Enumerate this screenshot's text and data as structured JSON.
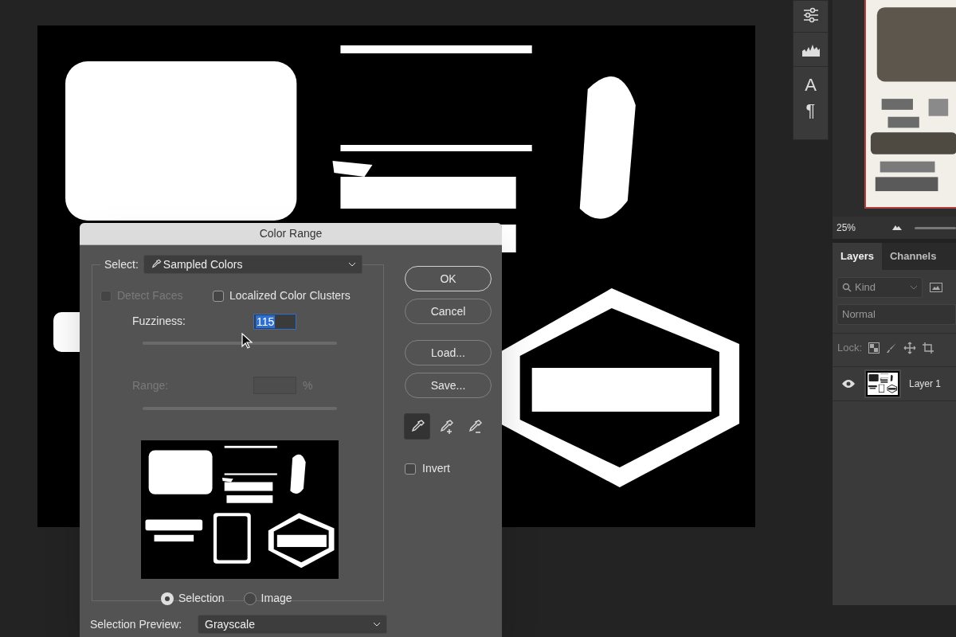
{
  "toolbar_glyphs": [
    "A",
    "¶"
  ],
  "navigator": {
    "zoom": "25%"
  },
  "layers_panel": {
    "tabs": [
      {
        "label": "Layers",
        "selected": true
      },
      {
        "label": "Channels",
        "selected": false
      }
    ],
    "filter": "Kind",
    "blend_mode": "Normal",
    "lock_label": "Lock:",
    "layers": [
      {
        "name": "Layer 1",
        "visible": true
      }
    ]
  },
  "dialog": {
    "title": "Color Range",
    "select_label": "Select:",
    "select_value": "Sampled Colors",
    "checkboxes": [
      {
        "label": "Detect Faces",
        "checked": false,
        "disabled": true
      },
      {
        "label": "Localized Color Clusters",
        "checked": false,
        "disabled": false
      }
    ],
    "fuzziness": {
      "label": "Fuzziness:",
      "value": "115",
      "level": 0.52
    },
    "range": {
      "label": "Range:",
      "unit": "%",
      "disabled": true
    },
    "preview_modes": [
      {
        "label": "Selection",
        "selected": true
      },
      {
        "label": "Image",
        "selected": false
      }
    ],
    "selection_preview": {
      "label": "Selection Preview:",
      "value": "Grayscale"
    },
    "buttons": [
      "OK",
      "Cancel",
      "Load...",
      "Save..."
    ],
    "eyedroppers": [
      {
        "kind": "sample",
        "selected": true
      },
      {
        "kind": "add",
        "selected": false
      },
      {
        "kind": "subtract",
        "selected": false
      }
    ],
    "invert": {
      "label": "Invert",
      "checked": false
    }
  }
}
